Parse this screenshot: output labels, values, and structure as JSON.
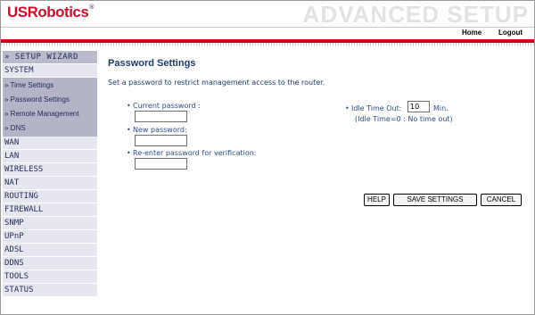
{
  "header": {
    "brand": "USRobotics",
    "brand_mark": "®",
    "banner_title": "ADVANCED SETUP",
    "nav": {
      "home": "Home",
      "logout": "Logout"
    },
    "accent_color": "#d0021b"
  },
  "sidebar": {
    "wizard": "» SETUP WIZARD",
    "system": "SYSTEM",
    "system_items": [
      "» Time Settings",
      "» Password Settings",
      "» Remote Management",
      "» DNS"
    ],
    "items": [
      "WAN",
      "LAN",
      "WIRELESS",
      "NAT",
      "ROUTING",
      "FIREWALL",
      "SNMP",
      "UPnP",
      "ADSL",
      "DDNS",
      "TOOLS",
      "STATUS"
    ]
  },
  "main": {
    "title": "Password Settings",
    "description": "Set a password to restrict management access to the router.",
    "fields": {
      "current_label": "Current password :",
      "current_value": "",
      "new_label": "New password:",
      "new_value": "",
      "reenter_label": "Re-enter password for verification:",
      "reenter_value": "",
      "idle_label": "Idle Time Out:",
      "idle_value": "10",
      "idle_unit": "Min.",
      "idle_note": "(Idle Time=0 : No time out)"
    },
    "buttons": {
      "help": "HELP",
      "save": "SAVE SETTINGS",
      "cancel": "CANCEL"
    }
  }
}
